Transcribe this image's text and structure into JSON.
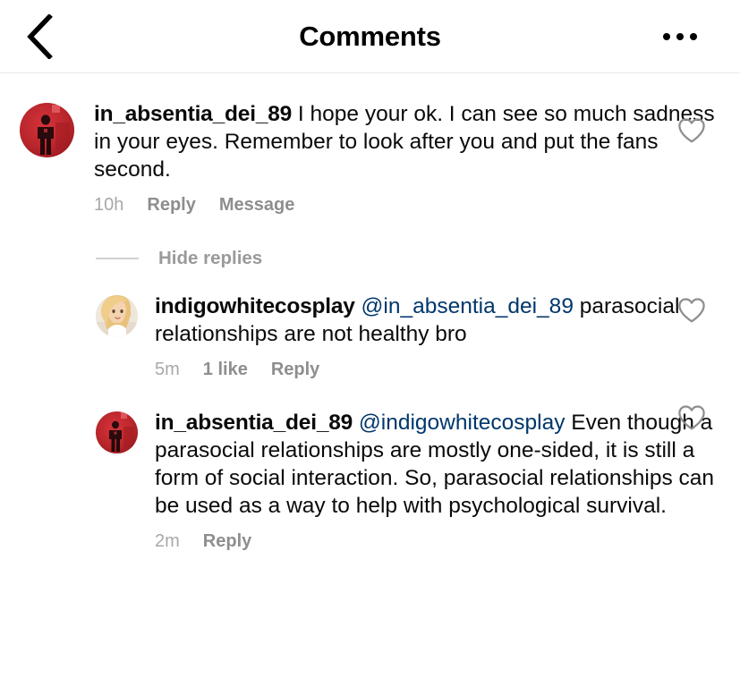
{
  "header": {
    "title": "Comments",
    "back_icon": "chevron-left-icon",
    "more_icon": "ellipsis-icon"
  },
  "colors": {
    "mention_link": "#00376b",
    "meta_time": "#a8a8a8",
    "meta_action": "#8e8e8e",
    "divider": "#e9e9e9",
    "avatar_red": "#b8252b"
  },
  "replies_toggle": {
    "label": "Hide replies"
  },
  "comments": [
    {
      "username": "in_absentia_dei_89",
      "mention": "",
      "text": "I hope your ok. I can see so much sadness in your eyes. Remember to look after you and put the fans second.",
      "time": "10h",
      "reply_label": "Reply",
      "message_label": "Message",
      "likes": "",
      "avatar": "avatar-red-figure",
      "like_icon": "heart-outline-icon"
    },
    {
      "username": "indigowhitecosplay",
      "mention": "@in_absentia_dei_89",
      "text": "parasocial relationships are not healthy bro",
      "time": "5m",
      "reply_label": "Reply",
      "message_label": "",
      "likes": "1 like",
      "avatar": "avatar-blonde-person",
      "like_icon": "heart-outline-icon"
    },
    {
      "username": "in_absentia_dei_89",
      "mention": "@indigowhitecosplay",
      "text": "Even though a parasocial relationships are mostly one-sided, it is still a form of social interaction. So, parasocial relationships can be used as a way to help with psychological survival.",
      "time": "2m",
      "reply_label": "Reply",
      "message_label": "",
      "likes": "",
      "avatar": "avatar-red-figure",
      "like_icon": "heart-outline-icon"
    }
  ]
}
